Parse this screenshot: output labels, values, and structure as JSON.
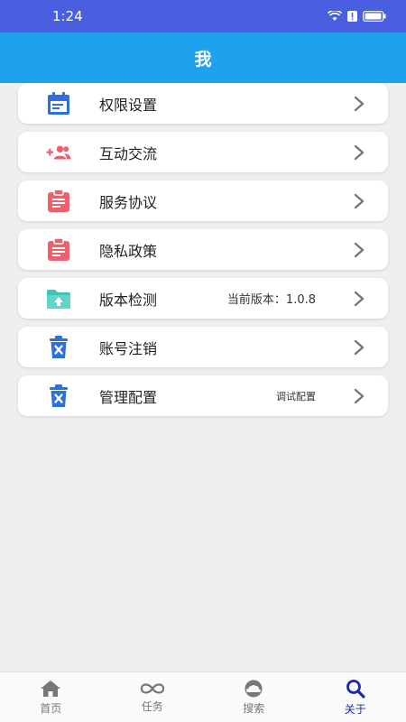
{
  "status_bar": {
    "time": "1:24"
  },
  "header": {
    "title": "我"
  },
  "menu": {
    "items": [
      {
        "label": "权限设置",
        "value": "",
        "icon": "calendar-icon"
      },
      {
        "label": "互动交流",
        "value": "",
        "icon": "add-group-icon"
      },
      {
        "label": "服务协议",
        "value": "",
        "icon": "clipboard-icon"
      },
      {
        "label": "隐私政策",
        "value": "",
        "icon": "clipboard-icon"
      },
      {
        "label": "版本检测",
        "value": "当前版本：1.0.8",
        "icon": "upload-folder-icon"
      },
      {
        "label": "账号注销",
        "value": "",
        "icon": "trash-icon"
      },
      {
        "label": "管理配置",
        "value": "调试配置",
        "icon": "trash-icon"
      }
    ]
  },
  "tabs": [
    {
      "label": "首页",
      "icon": "home-icon"
    },
    {
      "label": "任务",
      "icon": "infinity-icon"
    },
    {
      "label": "搜索",
      "icon": "cloud-icon"
    },
    {
      "label": "关于",
      "icon": "search-icon",
      "active": true
    }
  ],
  "colors": {
    "status_bar": "#4a5fe0",
    "header": "#1ea2ee",
    "accent_blue": "#2e6fdc",
    "accent_red": "#ef5f6c",
    "accent_teal": "#3ec5b6",
    "active_tab": "#1c2aa8"
  }
}
